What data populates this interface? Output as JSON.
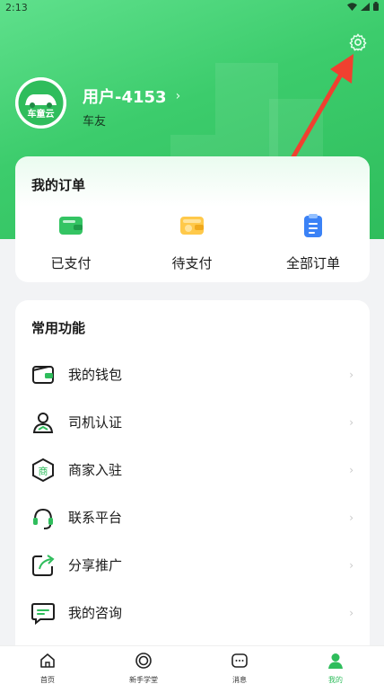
{
  "status_bar": {
    "time": "2:13"
  },
  "user": {
    "name": "用户-4153",
    "role": "车友",
    "avatar_text": "车童云"
  },
  "orders": {
    "title": "我的订单",
    "items": [
      {
        "label": "已支付",
        "icon": "wallet-paid-icon"
      },
      {
        "label": "待支付",
        "icon": "wallet-pending-icon"
      },
      {
        "label": "全部订单",
        "icon": "clipboard-list-icon"
      }
    ]
  },
  "functions": {
    "title": "常用功能",
    "items": [
      {
        "label": "我的钱包",
        "icon": "wallet-icon"
      },
      {
        "label": "司机认证",
        "icon": "driver-id-icon"
      },
      {
        "label": "商家入驻",
        "icon": "merchant-shop-icon"
      },
      {
        "label": "联系平台",
        "icon": "headset-icon"
      },
      {
        "label": "分享推广",
        "icon": "share-icon"
      },
      {
        "label": "我的咨询",
        "icon": "chat-message-icon"
      }
    ]
  },
  "tabs": [
    {
      "label": "首页",
      "icon": "home-icon",
      "active": false
    },
    {
      "label": "新手学堂",
      "icon": "academy-icon",
      "active": false
    },
    {
      "label": "消息",
      "icon": "message-icon",
      "active": false
    },
    {
      "label": "我的",
      "icon": "profile-icon",
      "active": true
    }
  ],
  "colors": {
    "brand_green": "#2fbd5c",
    "hero_light": "#5fe08c",
    "annotation_red": "#f04030"
  }
}
